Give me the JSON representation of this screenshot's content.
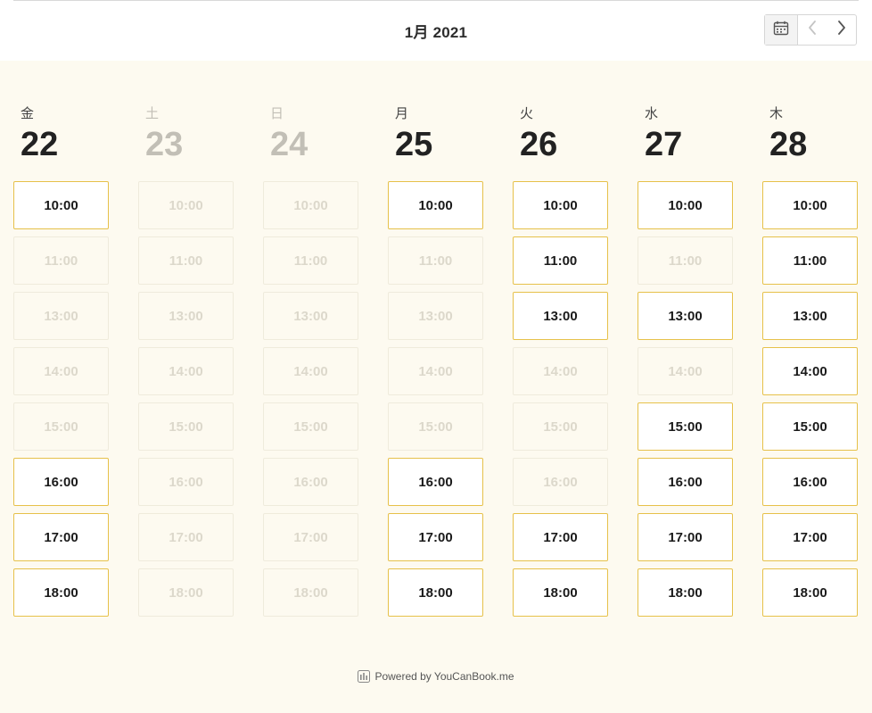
{
  "header": {
    "month_label": "1月 2021"
  },
  "days": [
    {
      "dow": "金",
      "date": "22",
      "available": true,
      "slots": [
        {
          "time": "10:00",
          "available": true
        },
        {
          "time": "11:00",
          "available": false
        },
        {
          "time": "13:00",
          "available": false
        },
        {
          "time": "14:00",
          "available": false
        },
        {
          "time": "15:00",
          "available": false
        },
        {
          "time": "16:00",
          "available": true
        },
        {
          "time": "17:00",
          "available": true
        },
        {
          "time": "18:00",
          "available": true
        }
      ]
    },
    {
      "dow": "土",
      "date": "23",
      "available": false,
      "slots": [
        {
          "time": "10:00",
          "available": false
        },
        {
          "time": "11:00",
          "available": false
        },
        {
          "time": "13:00",
          "available": false
        },
        {
          "time": "14:00",
          "available": false
        },
        {
          "time": "15:00",
          "available": false
        },
        {
          "time": "16:00",
          "available": false
        },
        {
          "time": "17:00",
          "available": false
        },
        {
          "time": "18:00",
          "available": false
        }
      ]
    },
    {
      "dow": "日",
      "date": "24",
      "available": false,
      "slots": [
        {
          "time": "10:00",
          "available": false
        },
        {
          "time": "11:00",
          "available": false
        },
        {
          "time": "13:00",
          "available": false
        },
        {
          "time": "14:00",
          "available": false
        },
        {
          "time": "15:00",
          "available": false
        },
        {
          "time": "16:00",
          "available": false
        },
        {
          "time": "17:00",
          "available": false
        },
        {
          "time": "18:00",
          "available": false
        }
      ]
    },
    {
      "dow": "月",
      "date": "25",
      "available": true,
      "slots": [
        {
          "time": "10:00",
          "available": true
        },
        {
          "time": "11:00",
          "available": false
        },
        {
          "time": "13:00",
          "available": false
        },
        {
          "time": "14:00",
          "available": false
        },
        {
          "time": "15:00",
          "available": false
        },
        {
          "time": "16:00",
          "available": true
        },
        {
          "time": "17:00",
          "available": true
        },
        {
          "time": "18:00",
          "available": true
        }
      ]
    },
    {
      "dow": "火",
      "date": "26",
      "available": true,
      "slots": [
        {
          "time": "10:00",
          "available": true
        },
        {
          "time": "11:00",
          "available": true
        },
        {
          "time": "13:00",
          "available": true
        },
        {
          "time": "14:00",
          "available": false
        },
        {
          "time": "15:00",
          "available": false
        },
        {
          "time": "16:00",
          "available": false
        },
        {
          "time": "17:00",
          "available": true
        },
        {
          "time": "18:00",
          "available": true
        }
      ]
    },
    {
      "dow": "水",
      "date": "27",
      "available": true,
      "slots": [
        {
          "time": "10:00",
          "available": true
        },
        {
          "time": "11:00",
          "available": false
        },
        {
          "time": "13:00",
          "available": true
        },
        {
          "time": "14:00",
          "available": false
        },
        {
          "time": "15:00",
          "available": true
        },
        {
          "time": "16:00",
          "available": true
        },
        {
          "time": "17:00",
          "available": true
        },
        {
          "time": "18:00",
          "available": true
        }
      ]
    },
    {
      "dow": "木",
      "date": "28",
      "available": true,
      "slots": [
        {
          "time": "10:00",
          "available": true
        },
        {
          "time": "11:00",
          "available": true
        },
        {
          "time": "13:00",
          "available": true
        },
        {
          "time": "14:00",
          "available": true
        },
        {
          "time": "15:00",
          "available": true
        },
        {
          "time": "16:00",
          "available": true
        },
        {
          "time": "17:00",
          "available": true
        },
        {
          "time": "18:00",
          "available": true
        }
      ]
    }
  ],
  "footer": {
    "powered_by": "Powered by YouCanBook.me"
  },
  "colors": {
    "background": "#fdfaf0",
    "slot_border_available": "#e6c14a",
    "slot_border_unavailable": "#efebdc"
  },
  "icons": {
    "calendar": "calendar-icon",
    "prev": "chevron-left-icon",
    "next": "chevron-right-icon",
    "footer_logo": "youcanbook-logo-icon"
  }
}
